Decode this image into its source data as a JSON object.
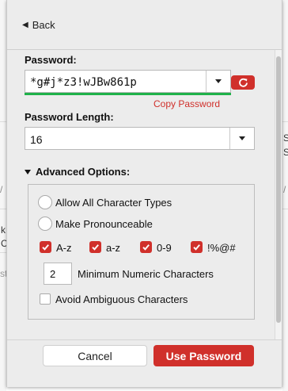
{
  "background": {
    "frag_s1": "S",
    "frag_s2": "S",
    "frag_k": "k",
    "frag_c": "C",
    "frag_st": "st",
    "frag_m": "/",
    "frag_m2": "/"
  },
  "nav": {
    "back_label": "Back"
  },
  "password": {
    "label": "Password:",
    "value": "*g#j*z3!wJBw861p",
    "copy_label": "Copy Password"
  },
  "length": {
    "label": "Password Length:",
    "value": "16"
  },
  "advanced": {
    "label": "Advanced Options:",
    "allow_all_label": "Allow All Character Types",
    "pronounceable_label": "Make Pronounceable",
    "charsets": [
      {
        "label": "A-z",
        "checked": true
      },
      {
        "label": "a-z",
        "checked": true
      },
      {
        "label": "0-9",
        "checked": true
      },
      {
        "label": "!%@#",
        "checked": true
      }
    ],
    "min_numeric_value": "2",
    "min_numeric_label": "Minimum Numeric Characters",
    "avoid_ambiguous_label": "Avoid Ambiguous Characters",
    "avoid_ambiguous_checked": false
  },
  "actions": {
    "cancel_label": "Cancel",
    "use_label": "Use Password"
  },
  "colors": {
    "accent": "#d0302b",
    "strength": "#1fb24a",
    "panel": "#ececec"
  }
}
